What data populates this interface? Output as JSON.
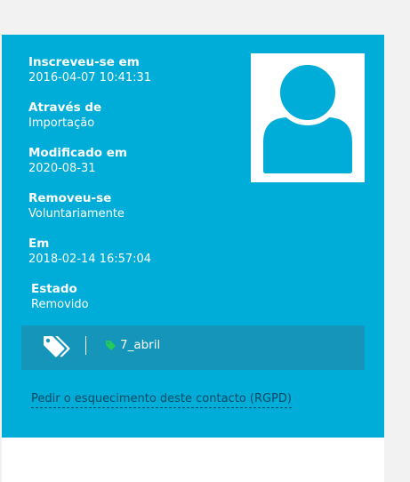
{
  "fields": [
    {
      "label": "Inscreveu-se em",
      "value": "2016-04-07 10:41:31"
    },
    {
      "label": "Através de",
      "value": "Importação"
    },
    {
      "label": "Modificado em",
      "value": "2020-08-31"
    },
    {
      "label": "Removeu-se",
      "value": "Voluntariamente"
    },
    {
      "label": "Em",
      "value": "2018-02-14 16:57:04"
    },
    {
      "label": "Estado",
      "value": "Removido"
    }
  ],
  "tags": {
    "icon": "tags-icon",
    "items": [
      {
        "label": "7_abril",
        "color": "#22cc55"
      }
    ]
  },
  "avatar": {
    "icon": "user-silhouette-icon"
  },
  "gdpr_link": "Pedir o esquecimento deste contacto (RGPD)",
  "colors": {
    "panel": "#00acd8",
    "tag_bar": "#1495b9",
    "link": "#0b4a63"
  }
}
